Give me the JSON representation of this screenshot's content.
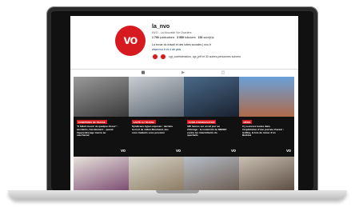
{
  "profile": {
    "avatar_text": "vo",
    "username": "la_nvo",
    "fullname": "NVO - La Nouvelle Vie Ouvrière",
    "stats": {
      "publications": "1 790",
      "publications_label": "publications",
      "followers": "3 559",
      "followers_label": "followers",
      "following": "151",
      "following_label": "suivi(e)s"
    },
    "bio": "La revue du travail et des luttes sociales | nvo.fr",
    "link": "www.nvo.fr et 4 de plus",
    "followed_by": "cgt_confederation, cgt_jeff et 30 autres personnes suivent"
  },
  "tabs": [
    {
      "name": "grid",
      "glyph": "▦"
    },
    {
      "name": "reels",
      "glyph": "▶"
    },
    {
      "name": "tagged",
      "glyph": "◫"
    }
  ],
  "posts": [
    {
      "tag": "CONDITIONS DE TRAVAIL",
      "title": "\"Il fallait mourir de quelque chose\" : accidents, harcèlement... quand l'apprentissage tourne au cauchemar",
      "photo": "#6d6d6d"
    },
    {
      "tag": "SANTÉ AU TRAVAIL",
      "title": "Syndicaux-hyper-exposés : derrière la mort de Julien Marchand, des cons tradunts sous pression",
      "photo": "#7f8b95"
    },
    {
      "tag": "CONFLIT/MOBILISATION",
      "title": "180 heures sur un tel jour au chômage : la modernité du MEDEF contre les intermittents du spectacle",
      "photo": "#2c3a4a"
    },
    {
      "tag": "MÉDIA",
      "title": "Il y a encore toutes dans l'exploitation d'une journée d'avant : la Mine, la fois du retour d'un Burkina",
      "photo": "#9c4a3a"
    }
  ],
  "colors": {
    "brand": "#d71920",
    "link": "#00376b"
  }
}
